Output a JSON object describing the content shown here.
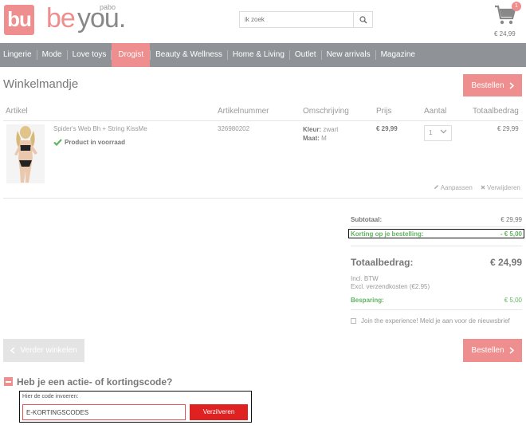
{
  "header": {
    "logo_mark": "bu",
    "logo_be": "be",
    "logo_you": "you.",
    "logo_pabo": "pabo",
    "search_placeholder": "ik zoek",
    "cart_count": "1",
    "cart_total": "€ 24,99"
  },
  "nav": {
    "items": [
      "Lingerie",
      "Mode",
      "Love toys",
      "Drogist",
      "Beauty & Wellness",
      "Home & Living",
      "Outlet",
      "New arrivals",
      "Magazine"
    ],
    "active": "Drogist"
  },
  "page": {
    "title": "Winkelmandje",
    "order_button": "Bestellen"
  },
  "table": {
    "headers": [
      "Artikel",
      "Artikelnummer",
      "Omschrijving",
      "Prijs",
      "Aantal",
      "Totaalbedrag"
    ],
    "row": {
      "name": "Spider's Web Bh + String KissMe",
      "stock": "Product in voorraad",
      "article_number": "326980202",
      "color_label": "Kleur:",
      "color_value": "zwart",
      "size_label": "Maat:",
      "size_value": "M",
      "price": "€ 29,99",
      "quantity": "1",
      "total": "€ 29,99",
      "edit": "Aanpassen",
      "remove": "Verwijderen"
    }
  },
  "summary": {
    "subtotal_label": "Subtotaal:",
    "subtotal_value": "€ 29,99",
    "discount_label": "Korting op je bestelling:",
    "discount_value": "- € 5,00",
    "total_label": "Totaalbedrag:",
    "total_value": "€ 24,99",
    "incl_vat": "Incl. BTW",
    "excl_shipping": "Excl. verzendkosten (€2.95)",
    "savings_label": "Besparing:",
    "savings_value": "€ 5,00",
    "newsletter": "Join the experience! Meld je aan voor de nieuwsbrief"
  },
  "actions": {
    "continue": "Verder winkelen",
    "order": "Bestellen"
  },
  "coupon": {
    "title": "Heb je een actie- of kortingscode?",
    "label": "Hier de code invoeren:",
    "value": "E-KORTINGSCODES",
    "submit": "Verzilveren"
  },
  "colors": {
    "accent": "#ef8e8e",
    "nav_bg": "#8f9397",
    "green": "#5fb55f",
    "submit_red": "#df2121"
  }
}
